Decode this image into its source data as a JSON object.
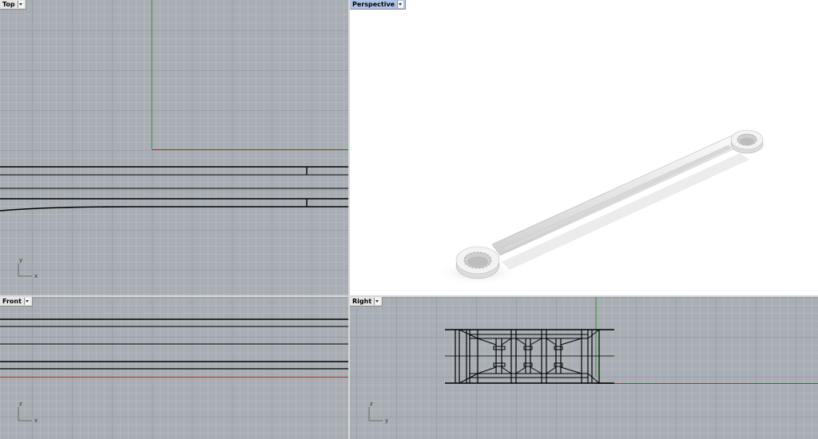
{
  "viewports": {
    "top": {
      "label": "Top",
      "axis_h": "x",
      "axis_v": "y"
    },
    "persp": {
      "label": "Perspective",
      "active": true
    },
    "front": {
      "label": "Front",
      "axis_h": "x",
      "axis_v": "z"
    },
    "right": {
      "label": "Right",
      "axis_h": "y",
      "axis_v": "z"
    }
  },
  "colors": {
    "grid_bg": "#a9aeb5",
    "x_axis": "#b03030",
    "y_axis": "#2e9c2e",
    "geometry": "#000000",
    "active_label": "#aec4e6"
  },
  "icons": [
    "dropdown-arrow-icon",
    "axis-gizmo-icon"
  ]
}
